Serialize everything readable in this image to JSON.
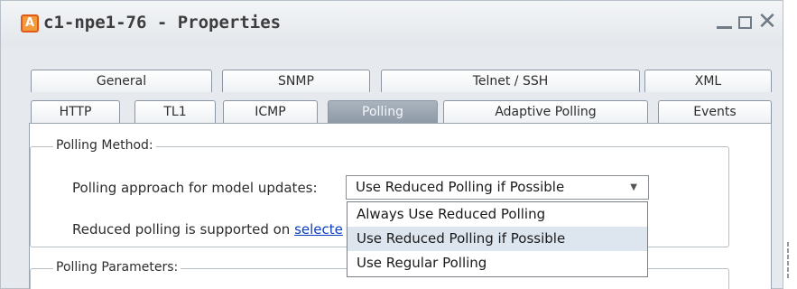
{
  "window": {
    "title": "c1-npe1-76 - Properties",
    "icon_letter": "A",
    "controls": [
      "minimize-icon",
      "maximize-icon",
      "close-icon"
    ]
  },
  "tabs_row1": [
    "General",
    "SNMP",
    "Telnet / SSH",
    "XML"
  ],
  "tabs_row2": [
    "HTTP",
    "TL1",
    "ICMP",
    "Polling",
    "Adaptive Polling",
    "Events"
  ],
  "active_tab": "Polling",
  "polling_method": {
    "legend": "Polling Method:",
    "approach_label": "Polling approach for model updates:",
    "selected": "Use Reduced Polling if Possible",
    "options": [
      "Always Use Reduced Polling",
      "Use Reduced Polling if Possible",
      "Use Regular Polling"
    ],
    "reduced_text": "Reduced polling is supported on ",
    "reduced_link": "selecte"
  },
  "polling_parameters": {
    "legend": "Polling Parameters:"
  },
  "colors": {
    "active_tab": "#9aa6b3",
    "link": "#0a3dbf",
    "highlight": "#dde5ef",
    "icon": "#f39a3c"
  }
}
